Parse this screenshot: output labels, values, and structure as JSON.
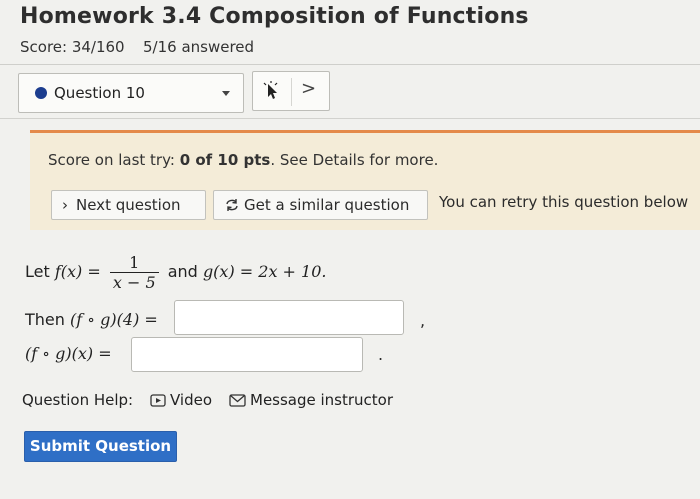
{
  "header": {
    "title": "Homework 3.4 Composition of Functions",
    "score": "Score: 34/160",
    "answered": "5/16 answered"
  },
  "question_select": {
    "label": "Question 10"
  },
  "nav": {
    "next_glyph": ">"
  },
  "feedback": {
    "prefix": "Score on last try: ",
    "score_bold": "0 of 10 pts",
    "suffix": ". See Details for more.",
    "next_button": "Next question",
    "similar_button": "Get a similar question",
    "retry_text": "You can retry this question below"
  },
  "problem": {
    "let_word": "Let",
    "f_lhs": "f(x) =",
    "f_num": "1",
    "f_den": "x − 5",
    "and_word": "and",
    "g_expr": "g(x) = 2x + 10.",
    "then_word": "Then",
    "q1_expr": "(f ∘ g)(4) =",
    "q1_suffix": ",",
    "q2_expr": "(f ∘ g)(x) =",
    "q2_suffix": ".",
    "answer1": "",
    "answer2": ""
  },
  "help": {
    "label": "Question Help:",
    "video": "Video",
    "message": "Message instructor"
  },
  "submit": {
    "label": "Submit Question"
  },
  "colors": {
    "accent_bar": "#e48a4a",
    "panel_bg": "#f4ecd8",
    "submit_bg": "#2f6fc6",
    "dot": "#1c3d8f"
  }
}
